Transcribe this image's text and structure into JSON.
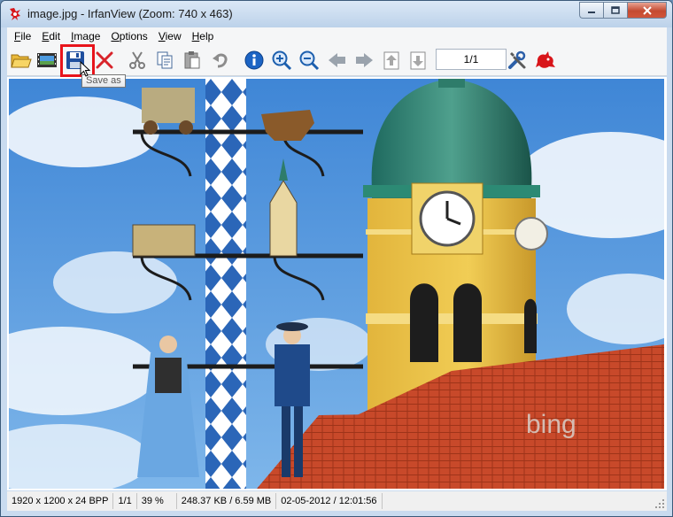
{
  "window": {
    "title": "image.jpg - IrfanView (Zoom: 740 x 463)",
    "app_icon": "irfanview-red-cat-icon"
  },
  "menu": [
    {
      "label": "File",
      "u": "F",
      "rest": "ile"
    },
    {
      "label": "Edit",
      "u": "E",
      "rest": "dit"
    },
    {
      "label": "Image",
      "u": "I",
      "rest": "mage"
    },
    {
      "label": "Options",
      "u": "O",
      "rest": "ptions"
    },
    {
      "label": "View",
      "u": "V",
      "rest": "iew"
    },
    {
      "label": "Help",
      "u": "H",
      "rest": "elp"
    }
  ],
  "toolbar": {
    "buttons": [
      "open-folder-icon",
      "slideshow-icon",
      "save-as-icon",
      "delete-icon",
      "cut-icon",
      "copy-icon",
      "paste-icon",
      "undo-icon",
      "info-icon",
      "zoom-in-icon",
      "zoom-out-icon",
      "previous-icon",
      "next-icon",
      "first-page-icon",
      "last-page-icon",
      "properties-icon",
      "irfanview-logo-icon"
    ],
    "page_indicator": "1/1",
    "tooltip": "Save as",
    "highlight_color": "#e8141b"
  },
  "image": {
    "watermark": "bing"
  },
  "status": {
    "dimensions": "1920 x 1200 x 24 BPP",
    "page": "1/1",
    "zoom": "39 %",
    "size": "248.37 KB / 6.59 MB",
    "date": "02-05-2012 / 12:01:56"
  }
}
